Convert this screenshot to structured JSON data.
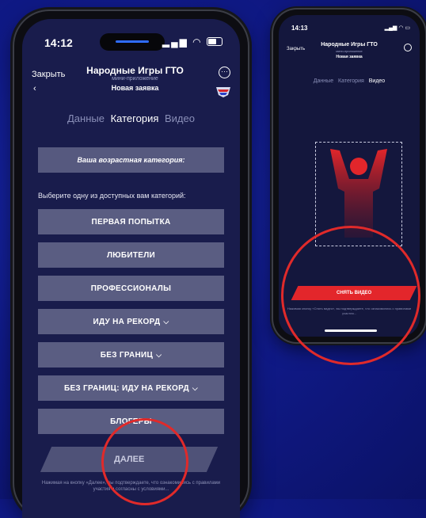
{
  "left_phone": {
    "status": {
      "time": "14:12"
    },
    "header": {
      "close_label": "Закрыть",
      "back_label": "‹",
      "title": "Народные Игры ГТО",
      "subtitle": "мини-приложение",
      "page_title": "Новая заявка"
    },
    "tabs": [
      {
        "label": "Данные",
        "active": false
      },
      {
        "label": "Категория",
        "active": true
      },
      {
        "label": "Видео",
        "active": false
      }
    ],
    "info_box": "Ваша возрастная категория:",
    "prompt": "Выберите одну из доступных вам категорий:",
    "categories": [
      {
        "label": "ПЕРВАЯ ПОПЫТКА"
      },
      {
        "label": "ЛЮБИТЕЛИ"
      },
      {
        "label": "ПРОФЕССИОНАЛЫ"
      },
      {
        "label": "ИДУ НА РЕКОРД"
      },
      {
        "label": "БЕЗ ГРАНИЦ"
      },
      {
        "label": "БЕЗ ГРАНИЦ: ИДУ НА РЕКОРД"
      },
      {
        "label": "БЛОГЕРЫ"
      }
    ],
    "next_label": "ДАЛЕЕ",
    "footer": "Нажимая на кнопку «Далее», вы подтверждаете, что ознакомились с правилами участия и согласны с условиями..."
  },
  "right_phone": {
    "status": {
      "time": "14:13"
    },
    "header": {
      "close_label": "Закрыть",
      "title": "Народные Игры ГТО",
      "subtitle": "мини-приложение",
      "page_title": "Новая заявка"
    },
    "tabs": [
      {
        "label": "Данные",
        "active": false
      },
      {
        "label": "Категория",
        "active": false
      },
      {
        "label": "Видео",
        "active": true
      }
    ],
    "shoot_label": "СНЯТЬ ВИДЕО",
    "footer": "Нажимая кнопку «Снять видео», вы подтверждаете, что ознакомились с правилами участия..."
  },
  "colors": {
    "background": "#101a8a",
    "screen": "#191c4c",
    "button": "#5a5d82",
    "accent_red": "#e3262b",
    "annotation_red": "#e02a2a"
  }
}
